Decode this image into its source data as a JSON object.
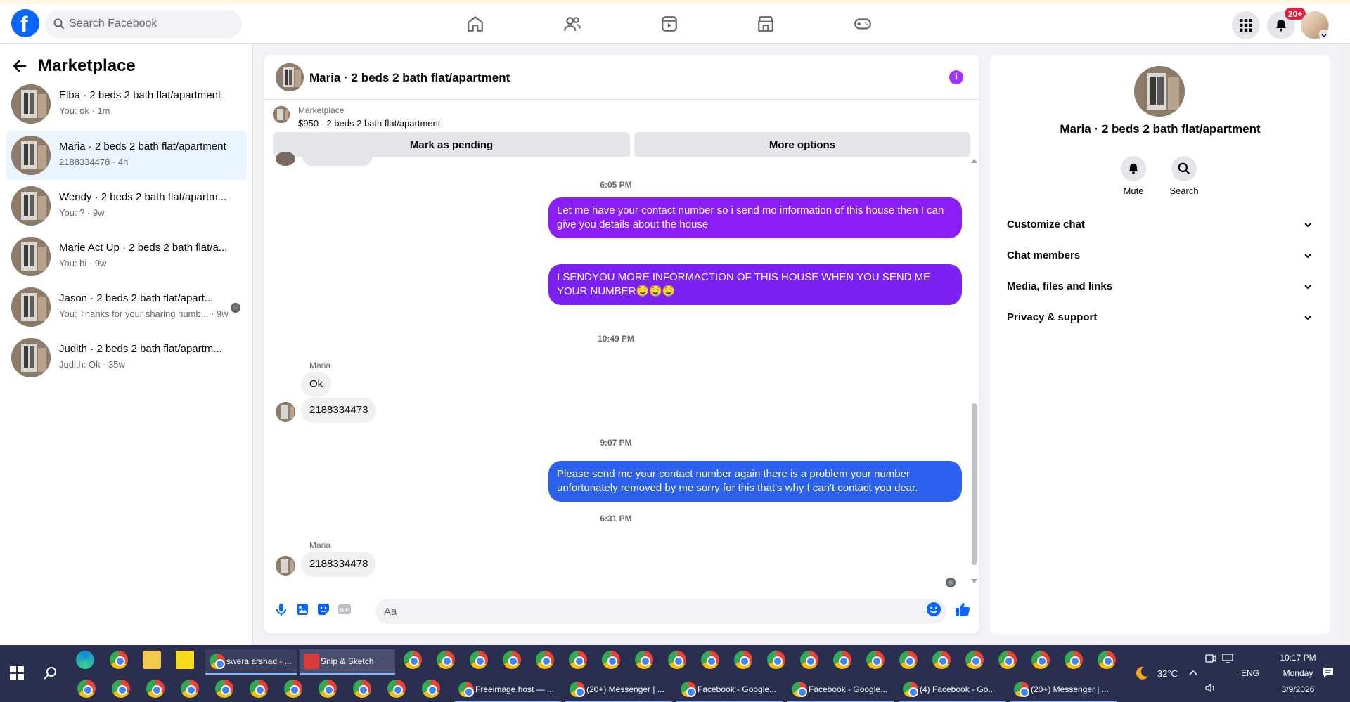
{
  "navbar": {
    "search_placeholder": "Search Facebook",
    "notification_badge": "20+"
  },
  "sidebar": {
    "title": "Marketplace",
    "conversations": [
      {
        "name": "Elba · 2 beds 2 bath flat/apartment",
        "preview": "You: ok · 1m"
      },
      {
        "name": "Maria · 2 beds 2 bath flat/apartment",
        "preview": "2188334478 · 4h"
      },
      {
        "name": "Wendy · 2 beds 2 bath flat/apartm...",
        "preview": "You: ? · 9w"
      },
      {
        "name": "Marie Act Up · 2 beds 2 bath flat/a...",
        "preview": "You: hi · 9w"
      },
      {
        "name": "Jason · 2 beds 2 bath flat/apart...",
        "preview": "You: Thanks for your sharing numb... · 9w"
      },
      {
        "name": "Judith · 2 beds 2 bath flat/apartm...",
        "preview": "Judith: Ok · 35w"
      }
    ]
  },
  "chat": {
    "title": "Maria · 2 beds 2 bath flat/apartment",
    "marketplace_label": "Marketplace",
    "listing": "$950 - 2 beds 2 bath flat/apartment",
    "mark_pending": "Mark as pending",
    "more_options": "More options",
    "messages": {
      "t1": "6:05 PM",
      "out1": "Let me have your contact number so i send mo information of this house   then I can give you details about the house",
      "out2": "I SENDYOU MORE INFORMACTION OF THIS HOUSE  WHEN YOU SEND ME  YOUR NUMBER🤤🤤🤤",
      "t2": "10:49 PM",
      "sender1": "Maria",
      "in1": "Ok",
      "in2": "2188334473",
      "t3": "9:07 PM",
      "out3": "Please send me your contact number again there is a problem your number unfortunately removed by me sorry for this that's why I can't contact you dear.",
      "t4": "6:31 PM",
      "sender2": "Maria",
      "in3": "2188334478"
    },
    "composer_placeholder": "Aa",
    "colors": {
      "purple": "#8a1ef5",
      "purple_dark": "#7b22f2",
      "blue": "#2b61ee"
    }
  },
  "panel": {
    "name": "Maria · 2 beds 2 bath flat/apartment",
    "mute": "Mute",
    "search": "Search",
    "sections": [
      "Customize chat",
      "Chat members",
      "Media, files and links",
      "Privacy & support"
    ]
  },
  "taskbar": {
    "item1": "swera arshad - ...",
    "item2": "Snip & Sketch",
    "item3": "Freeimage.host — ...",
    "item4": "(20+) Messenger | ...",
    "item5": "Facebook - Google...",
    "item6": "Facebook - Google...",
    "item7": "(4) Facebook - Go...",
    "item8": "(20+) Messenger | ...",
    "temperature": "32°C",
    "language": "ENG",
    "time": "10:17 PM",
    "day": "Monday",
    "date": "3/9/2026"
  }
}
